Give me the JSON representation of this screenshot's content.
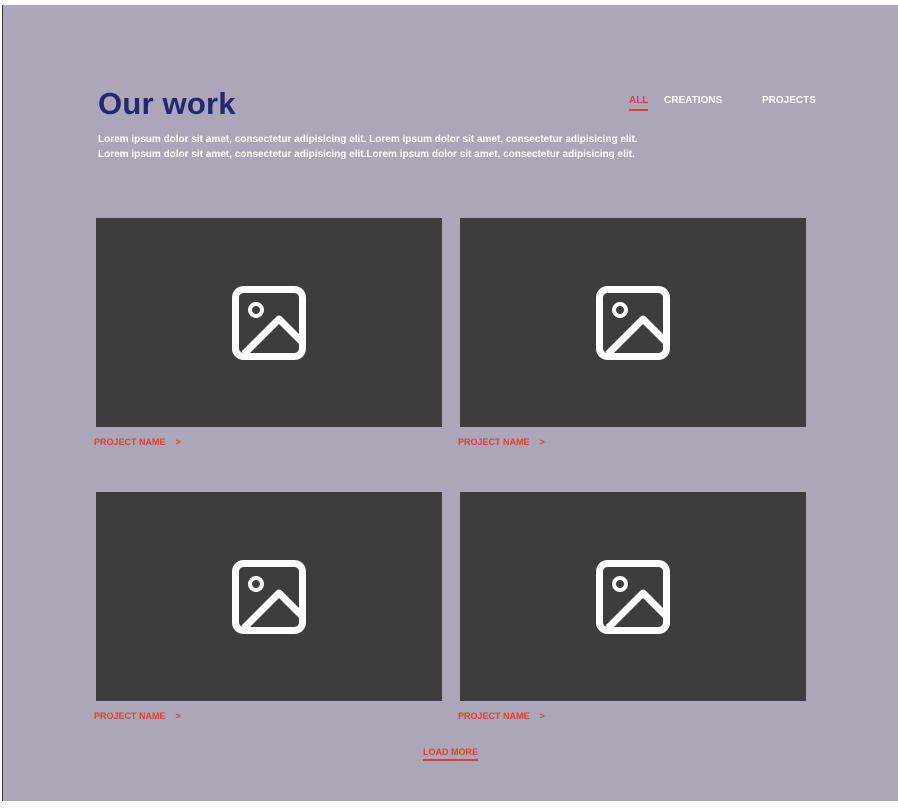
{
  "header": {
    "title": "Our work",
    "intro_line_1": "Lorem ipsum dolor sit amet, consectetur adipisicing elit. Lorem ipsum dolor sit amet, consectetur adipisicing elit.",
    "intro_line_2": "Lorem ipsum dolor sit amet, consectetur adipisicing elit.Lorem ipsum dolor sit amet, consectetur adipisicing elit."
  },
  "filters": [
    {
      "label": "ALL",
      "active": true
    },
    {
      "label": "CREATIONS",
      "active": false
    },
    {
      "label": "PROJECTS",
      "active": false
    }
  ],
  "projects": [
    {
      "name": "PROJECT NAME",
      "icon": "image-placeholder-icon",
      "link_icon": "chevron-right-icon",
      "link_glyph": ">"
    },
    {
      "name": "PROJECT NAME",
      "icon": "image-placeholder-icon",
      "link_icon": "chevron-right-icon",
      "link_glyph": ">"
    },
    {
      "name": "PROJECT NAME",
      "icon": "image-placeholder-icon",
      "link_icon": "chevron-right-icon",
      "link_glyph": ">"
    },
    {
      "name": "PROJECT NAME",
      "icon": "image-placeholder-icon",
      "link_icon": "chevron-right-icon",
      "link_glyph": ">"
    }
  ],
  "load_more_label": "LOAD MORE",
  "colors": {
    "background": "#aba7b9",
    "title": "#232871",
    "accent": "#e23d2f",
    "thumbnail": "#3d3d3d",
    "text_light": "#ffffff"
  }
}
